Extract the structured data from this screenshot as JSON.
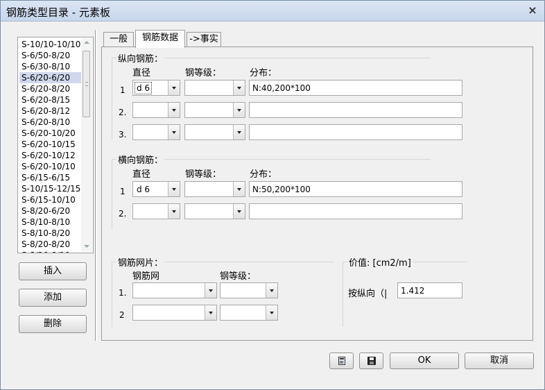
{
  "window": {
    "title": "钢筋类型目录 - 元素板",
    "close_icon": "×"
  },
  "list": {
    "items": [
      "S-10/10-10/10",
      "S-6/50-8/20",
      "S-6/30-8/10",
      "S-6/20-6/20",
      "S-6/20-8/20",
      "S-6/20-8/15",
      "S-6/20-8/12",
      "S-6/20-8/10",
      "S-6/20-10/20",
      "S-6/20-10/15",
      "S-6/20-10/12",
      "S-6/20-10/10",
      "S-6/15-6/15",
      "S-10/15-12/15",
      "S-6/15-10/10",
      "S-8/20-6/20",
      "S-8/10-8/10",
      "S-8/10-8/20",
      "S-8/20-8/20",
      "S-8/20-8/10"
    ],
    "selected_index": 3
  },
  "left_buttons": {
    "insert": "插入",
    "add": "添加",
    "delete": "删除"
  },
  "tabs": [
    {
      "label": "一般"
    },
    {
      "label": "钢筋数据",
      "active": true
    },
    {
      "label": "->事实"
    }
  ],
  "longitudinal": {
    "title": "纵向钢筋：",
    "col_diameter": "直径",
    "col_grade": "钢等级：",
    "col_distribution": "分布：",
    "rows": [
      {
        "num": "1",
        "diameter": "d 6",
        "grade": "",
        "distribution": "N:40,200*100"
      },
      {
        "num": "2.",
        "diameter": "",
        "grade": "",
        "distribution": ""
      },
      {
        "num": "3.",
        "diameter": "",
        "grade": "",
        "distribution": ""
      }
    ]
  },
  "transverse": {
    "title": "横向钢筋：",
    "col_diameter": "直径",
    "col_grade": "钢等级：",
    "col_distribution": "分布：",
    "rows": [
      {
        "num": "1",
        "diameter": "d 6",
        "grade": "",
        "distribution": "N:50,200*100"
      },
      {
        "num": "2.",
        "diameter": "",
        "grade": "",
        "distribution": ""
      }
    ]
  },
  "mesh": {
    "title": "钢筋网片：",
    "col_mesh": "钢筋网",
    "col_grade": "钢等级：",
    "rows": [
      {
        "num": "1.",
        "mesh": "",
        "grade": ""
      },
      {
        "num": "2",
        "mesh": "",
        "grade": ""
      }
    ]
  },
  "value": {
    "title": "价值: [cm2/m]",
    "label": "按纵向（|",
    "amount": "1.412"
  },
  "bottom_buttons": {
    "calculator_icon": "calculator-icon",
    "save_icon": "save-icon",
    "ok": "OK",
    "cancel": "取消"
  }
}
